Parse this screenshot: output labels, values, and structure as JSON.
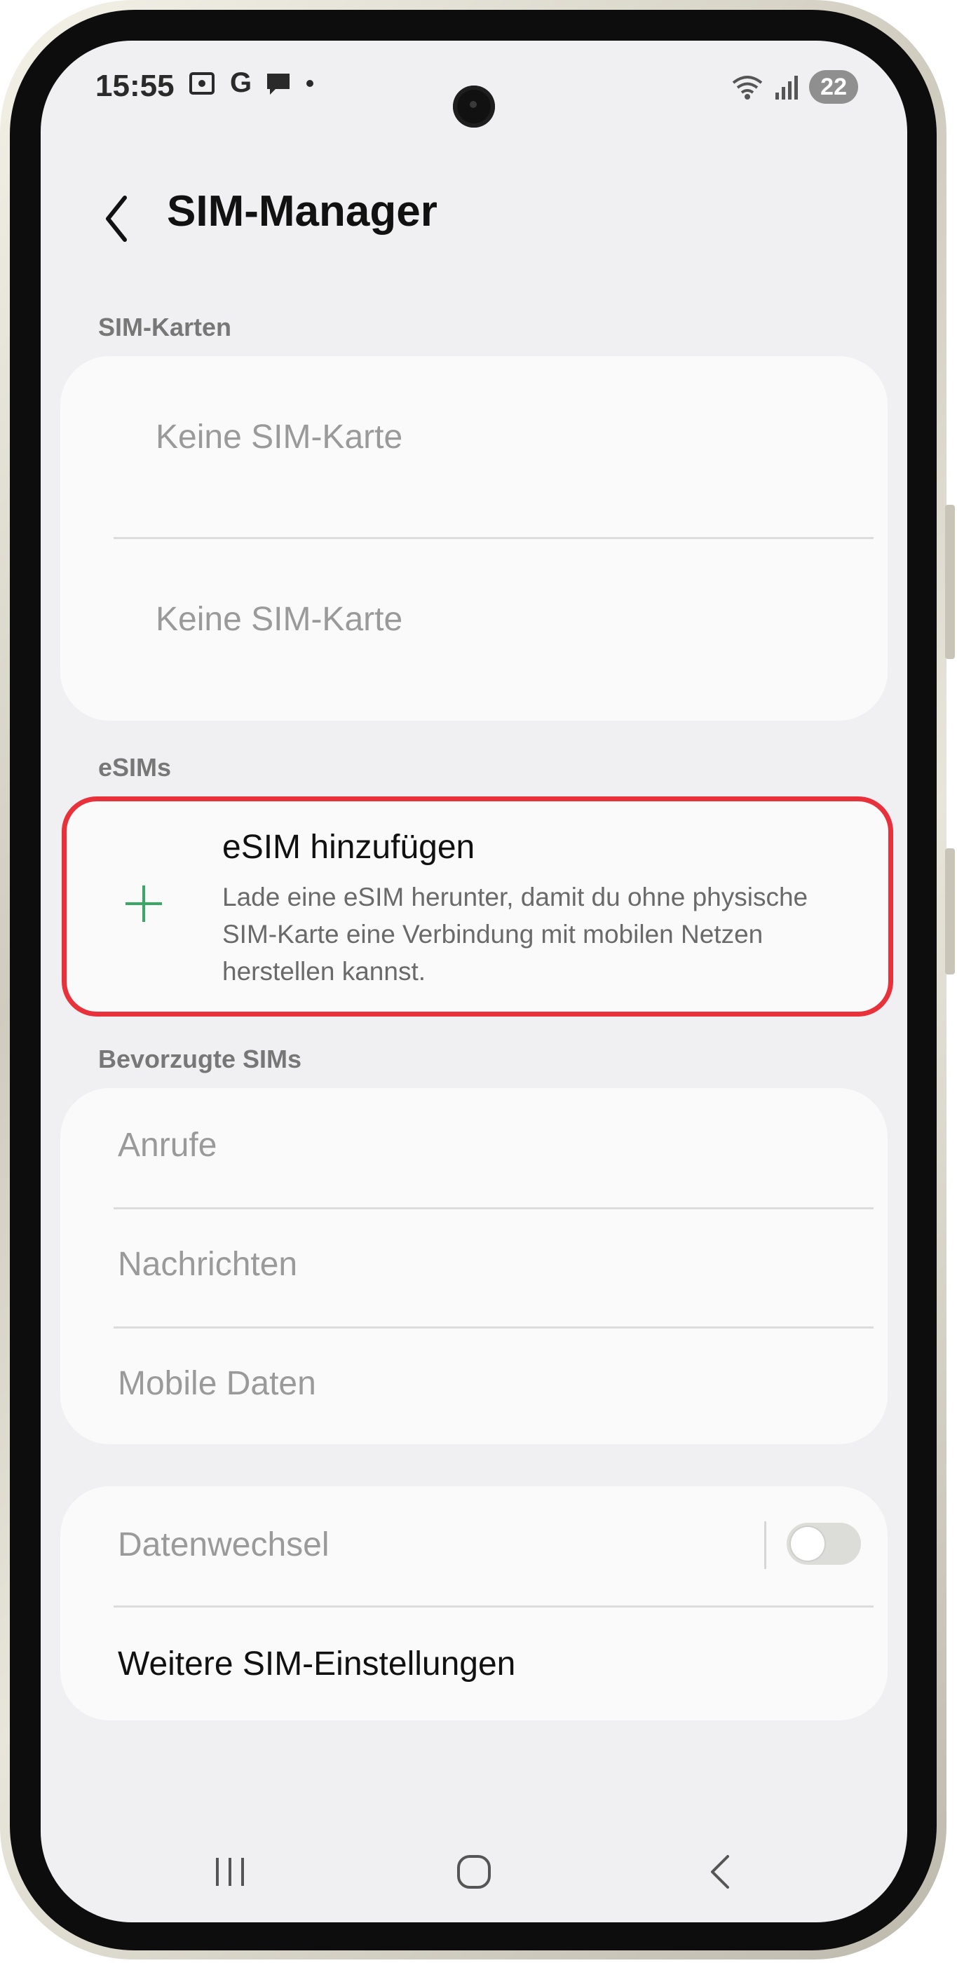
{
  "status_bar": {
    "time": "15:55",
    "left_icons": [
      "screenshot-icon",
      "google-icon",
      "messages-icon",
      "dot-icon"
    ],
    "battery": "22"
  },
  "header": {
    "title": "SIM-Manager"
  },
  "sim_cards": {
    "section_label": "SIM-Karten",
    "slots": [
      {
        "label": "Keine SIM-Karte"
      },
      {
        "label": "Keine SIM-Karte"
      }
    ]
  },
  "esims": {
    "section_label": "eSIMs",
    "add_title": "eSIM hinzufügen",
    "add_description": "Lade eine eSIM herunter, damit du ohne physische SIM-Karte eine Verbindung mit mobilen Netzen herstellen kannst.",
    "highlight_color": "#e8313a",
    "plus_color": "#3aa865"
  },
  "preferred_sims": {
    "section_label": "Bevorzugte SIMs",
    "items": [
      {
        "label": "Anrufe"
      },
      {
        "label": "Nachrichten"
      },
      {
        "label": "Mobile Daten"
      }
    ]
  },
  "more": {
    "data_switch_label": "Datenwechsel",
    "data_switch_on": false,
    "more_settings_label": "Weitere SIM-Einstellungen"
  },
  "nav_bar": {
    "buttons": [
      "recents-icon",
      "home-icon",
      "back-icon"
    ]
  }
}
